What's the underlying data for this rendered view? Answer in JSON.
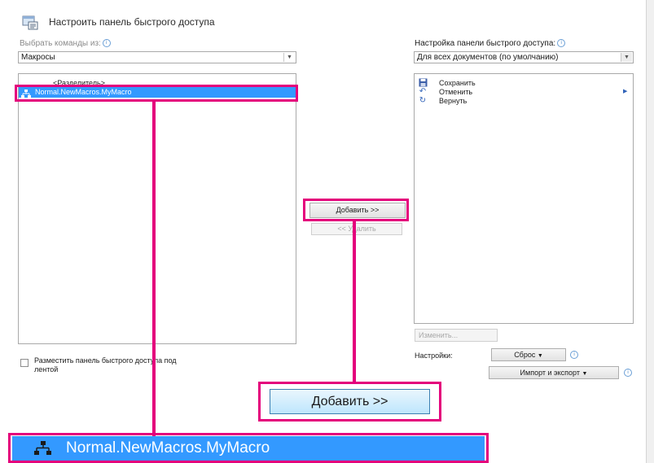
{
  "dialog": {
    "title": "Настроить панель быстрого доступа"
  },
  "left": {
    "choose_label": "Выбрать команды из:",
    "choose_value": "Макросы",
    "items": [
      "<Разделитель>",
      "Normal.NewMacros.MyMacro"
    ],
    "checkbox_label_line1": "Разместить панель быстрого доступа под",
    "checkbox_label_line2": "лентой"
  },
  "middle": {
    "add_label": "Добавить >>",
    "remove_label": "<< Удалить"
  },
  "right": {
    "customize_label": "Настройка панели быстрого доступа:",
    "customize_value": "Для всех документов (по умолчанию)",
    "items": [
      {
        "label": "Сохранить",
        "icon": "save-icon"
      },
      {
        "label": "Отменить",
        "icon": "undo-icon"
      },
      {
        "label": "Вернуть",
        "icon": "redo-icon"
      }
    ],
    "modify_label": "Изменить...",
    "settings_label": "Настройки:",
    "reset_label": "Сброс",
    "import_export_label": "Импорт и экспорт"
  },
  "callouts": {
    "add_button_zoom": "Добавить >>",
    "macro_zoom": "Normal.NewMacros.MyMacro"
  },
  "colors": {
    "highlight": "#e4007c",
    "selection": "#3399ff"
  }
}
